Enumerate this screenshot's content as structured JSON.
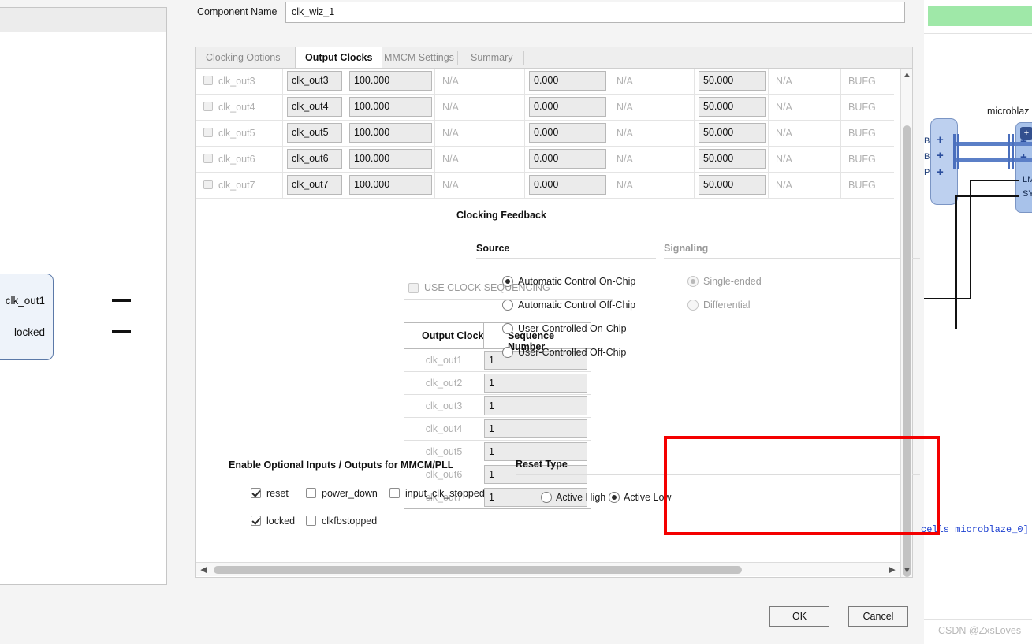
{
  "background": {
    "block_label_clk_out1": "clk_out1",
    "block_label_locked": "locked",
    "microblaze_label": "microblaz",
    "tcl_text": "cells microblaze_0]",
    "watermark": "CSDN @ZxsLoves",
    "signal_lm": "LM",
    "signal_sy": "SY"
  },
  "dialog": {
    "component_name_label": "Component Name",
    "component_name_value": "clk_wiz_1",
    "tabs": [
      {
        "label": "Clocking Options",
        "active": false
      },
      {
        "label": "Output Clocks",
        "active": true
      },
      {
        "label": "MMCM Settings",
        "active": false
      },
      {
        "label": "Summary",
        "active": false
      }
    ],
    "ok_label": "OK",
    "cancel_label": "Cancel"
  },
  "clock_table": {
    "rows": [
      {
        "enable_label": "clk_out3",
        "port_name": "clk_out3",
        "requested_freq": "100.000",
        "actual_freq": "N/A",
        "requested_phase": "0.000",
        "actual_phase": "N/A",
        "requested_duty": "50.000",
        "actual_duty": "N/A",
        "drives": "BUFG"
      },
      {
        "enable_label": "clk_out4",
        "port_name": "clk_out4",
        "requested_freq": "100.000",
        "actual_freq": "N/A",
        "requested_phase": "0.000",
        "actual_phase": "N/A",
        "requested_duty": "50.000",
        "actual_duty": "N/A",
        "drives": "BUFG"
      },
      {
        "enable_label": "clk_out5",
        "port_name": "clk_out5",
        "requested_freq": "100.000",
        "actual_freq": "N/A",
        "requested_phase": "0.000",
        "actual_phase": "N/A",
        "requested_duty": "50.000",
        "actual_duty": "N/A",
        "drives": "BUFG"
      },
      {
        "enable_label": "clk_out6",
        "port_name": "clk_out6",
        "requested_freq": "100.000",
        "actual_freq": "N/A",
        "requested_phase": "0.000",
        "actual_phase": "N/A",
        "requested_duty": "50.000",
        "actual_duty": "N/A",
        "drives": "BUFG"
      },
      {
        "enable_label": "clk_out7",
        "port_name": "clk_out7",
        "requested_freq": "100.000",
        "actual_freq": "N/A",
        "requested_phase": "0.000",
        "actual_phase": "N/A",
        "requested_duty": "50.000",
        "actual_duty": "N/A",
        "drives": "BUFG"
      }
    ]
  },
  "sequencing": {
    "use_clock_sequencing_label": "USE CLOCK SEQUENCING",
    "use_clock_sequencing_checked": false,
    "header_output_clock": "Output Clock",
    "header_sequence_number": "Sequence Number",
    "rows": [
      {
        "name": "clk_out1",
        "value": "1"
      },
      {
        "name": "clk_out2",
        "value": "1"
      },
      {
        "name": "clk_out3",
        "value": "1"
      },
      {
        "name": "clk_out4",
        "value": "1"
      },
      {
        "name": "clk_out5",
        "value": "1"
      },
      {
        "name": "clk_out6",
        "value": "1"
      },
      {
        "name": "clk_out7",
        "value": "1"
      }
    ]
  },
  "clocking_feedback": {
    "title": "Clocking Feedback",
    "source_title": "Source",
    "signaling_title": "Signaling",
    "source_options": [
      {
        "label": "Automatic Control On-Chip",
        "selected": true
      },
      {
        "label": "Automatic Control Off-Chip",
        "selected": false
      },
      {
        "label": "User-Controlled On-Chip",
        "selected": false
      },
      {
        "label": "User-Controlled Off-Chip",
        "selected": false
      }
    ],
    "signaling_options": [
      {
        "label": "Single-ended",
        "selected": true
      },
      {
        "label": "Differential",
        "selected": false
      }
    ]
  },
  "optional_io": {
    "title": "Enable Optional Inputs / Outputs for MMCM/PLL",
    "items": [
      {
        "label": "reset",
        "checked": true
      },
      {
        "label": "power_down",
        "checked": false
      },
      {
        "label": "input_clk_stopped",
        "checked": false
      },
      {
        "label": "locked",
        "checked": true
      },
      {
        "label": "clkfbstopped",
        "checked": false
      }
    ]
  },
  "reset_type": {
    "title": "Reset Type",
    "options": [
      {
        "label": "Active High",
        "selected": false
      },
      {
        "label": "Active Low",
        "selected": true
      }
    ],
    "highlight_color": "#f40000"
  }
}
